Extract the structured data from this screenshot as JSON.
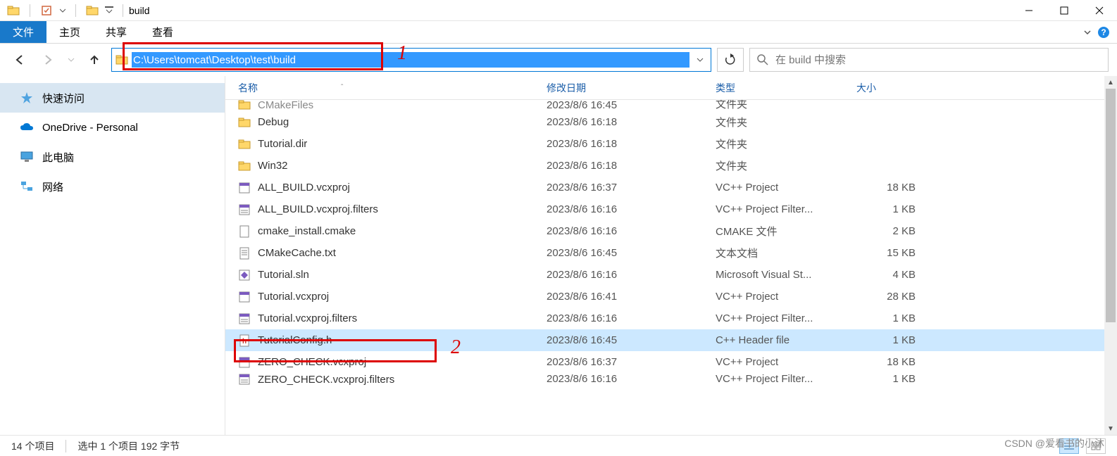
{
  "window": {
    "title": "build"
  },
  "ribbon": {
    "file": "文件",
    "tabs": [
      "主页",
      "共享",
      "查看"
    ]
  },
  "address": {
    "path": "C:\\Users\\tomcat\\Desktop\\test\\build",
    "annot1": "1"
  },
  "search": {
    "placeholder": "在 build 中搜索"
  },
  "sidebar": {
    "items": [
      {
        "label": "快速访问",
        "icon": "star",
        "selected": true
      },
      {
        "label": "OneDrive - Personal",
        "icon": "cloud",
        "selected": false
      },
      {
        "label": "此电脑",
        "icon": "pc",
        "selected": false
      },
      {
        "label": "网络",
        "icon": "network",
        "selected": false
      }
    ]
  },
  "columns": {
    "name": "名称",
    "date": "修改日期",
    "type": "类型",
    "size": "大小"
  },
  "files": [
    {
      "name": "CMakeFiles",
      "date": "2023/8/6 16:45",
      "type": "文件夹",
      "size": "",
      "icon": "folder",
      "cut": "top"
    },
    {
      "name": "Debug",
      "date": "2023/8/6 16:18",
      "type": "文件夹",
      "size": "",
      "icon": "folder"
    },
    {
      "name": "Tutorial.dir",
      "date": "2023/8/6 16:18",
      "type": "文件夹",
      "size": "",
      "icon": "folder"
    },
    {
      "name": "Win32",
      "date": "2023/8/6 16:18",
      "type": "文件夹",
      "size": "",
      "icon": "folder"
    },
    {
      "name": "ALL_BUILD.vcxproj",
      "date": "2023/8/6 16:37",
      "type": "VC++ Project",
      "size": "18 KB",
      "icon": "vcxproj"
    },
    {
      "name": "ALL_BUILD.vcxproj.filters",
      "date": "2023/8/6 16:16",
      "type": "VC++ Project Filter...",
      "size": "1 KB",
      "icon": "filters"
    },
    {
      "name": "cmake_install.cmake",
      "date": "2023/8/6 16:16",
      "type": "CMAKE 文件",
      "size": "2 KB",
      "icon": "file"
    },
    {
      "name": "CMakeCache.txt",
      "date": "2023/8/6 16:45",
      "type": "文本文档",
      "size": "15 KB",
      "icon": "txt"
    },
    {
      "name": "Tutorial.sln",
      "date": "2023/8/6 16:16",
      "type": "Microsoft Visual St...",
      "size": "4 KB",
      "icon": "sln"
    },
    {
      "name": "Tutorial.vcxproj",
      "date": "2023/8/6 16:41",
      "type": "VC++ Project",
      "size": "28 KB",
      "icon": "vcxproj"
    },
    {
      "name": "Tutorial.vcxproj.filters",
      "date": "2023/8/6 16:16",
      "type": "VC++ Project Filter...",
      "size": "1 KB",
      "icon": "filters"
    },
    {
      "name": "TutorialConfig.h",
      "date": "2023/8/6 16:45",
      "type": "C++ Header file",
      "size": "1 KB",
      "icon": "h",
      "selected": true
    },
    {
      "name": "ZERO_CHECK.vcxproj",
      "date": "2023/8/6 16:37",
      "type": "VC++ Project",
      "size": "18 KB",
      "icon": "vcxproj"
    },
    {
      "name": "ZERO_CHECK.vcxproj.filters",
      "date": "2023/8/6 16:16",
      "type": "VC++ Project Filter...",
      "size": "1 KB",
      "icon": "filters",
      "cut": "bottom"
    }
  ],
  "row_annot": {
    "num": "2"
  },
  "status": {
    "count": "14 个项目",
    "selection": "选中 1 个项目 192 字节"
  },
  "watermark": "CSDN @爱看书的小沐"
}
